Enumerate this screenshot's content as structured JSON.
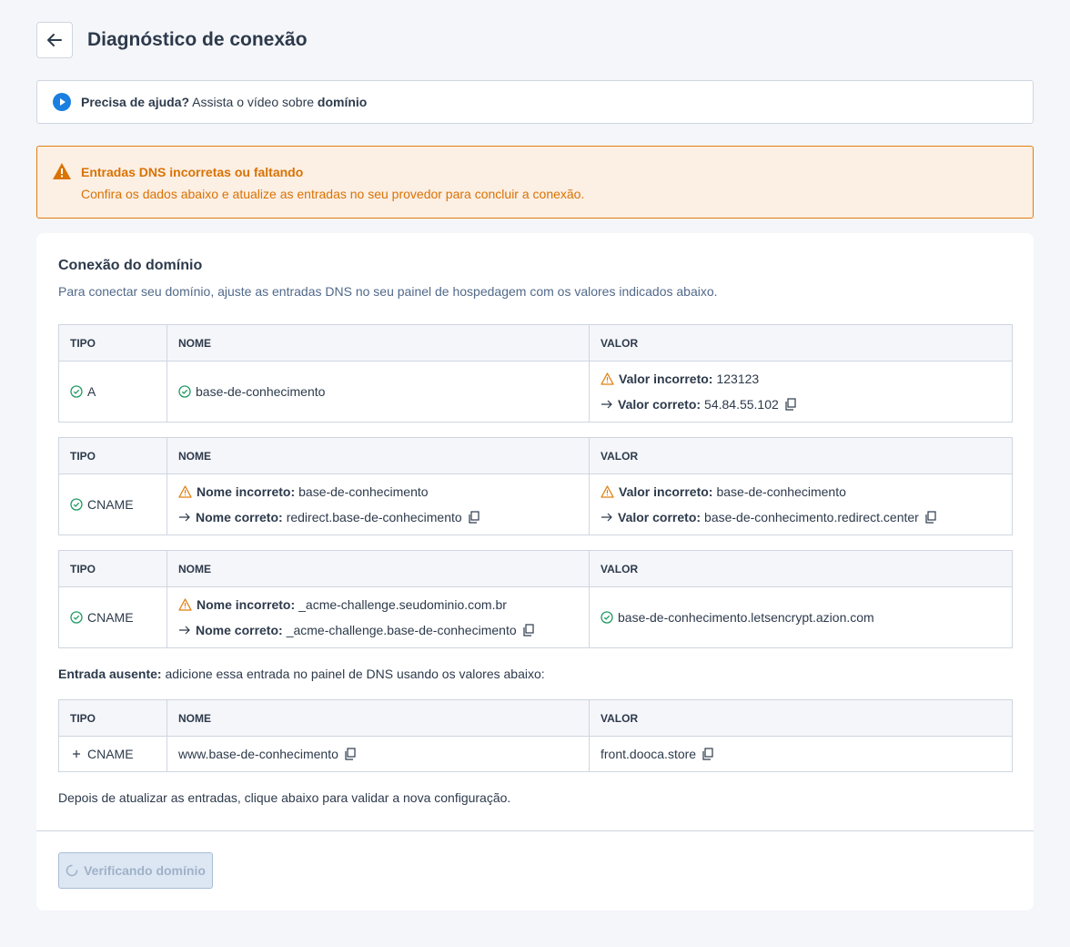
{
  "header": {
    "title": "Diagnóstico de conexão"
  },
  "help": {
    "bold": "Precisa de ajuda?",
    "text": " Assista o vídeo sobre ",
    "link": "domínio"
  },
  "alert": {
    "title": "Entradas DNS incorretas ou faltando",
    "text": "Confira os dados abaixo e atualize as entradas no seu provedor para concluir a conexão."
  },
  "card": {
    "title": "Conexão do domínio",
    "subtitle": "Para conectar seu domínio, ajuste as entradas DNS no seu painel de hospedagem com os valores indicados abaixo."
  },
  "columns": {
    "tipo": "TIPO",
    "nome": "NOME",
    "valor": "VALOR"
  },
  "labels": {
    "valor_incorreto": "Valor incorreto:",
    "valor_correto": "Valor correto:",
    "nome_incorreto": "Nome incorreto:",
    "nome_correto": "Nome correto:"
  },
  "records": [
    {
      "tipo": "A",
      "nome": "base-de-conhecimento",
      "valor_incorreto": "123123",
      "valor_correto": "54.84.55.102"
    },
    {
      "tipo": "CNAME",
      "nome_incorreto": "base-de-conhecimento",
      "nome_correto": "redirect.base-de-conhecimento",
      "valor_incorreto": "base-de-conhecimento",
      "valor_correto": "base-de-conhecimento.redirect.center"
    },
    {
      "tipo": "CNAME",
      "nome_incorreto": "_acme-challenge.seudominio.com.br",
      "nome_correto": "_acme-challenge.base-de-conhecimento",
      "valor": "base-de-conhecimento.letsencrypt.azion.com"
    }
  ],
  "absent": {
    "bold": "Entrada ausente:",
    "text": " adicione essa entrada no painel de DNS usando os valores abaixo:",
    "tipo": "CNAME",
    "nome": "www.base-de-conhecimento",
    "valor": "front.dooca.store"
  },
  "after_note": "Depois de atualizar as entradas, clique abaixo para validar a nova configuração.",
  "verify_button": "Verificando domínio",
  "colors": {
    "ok": "#1f9a62",
    "warn": "#e07f10",
    "accent": "#1a7fe0",
    "text": "#2d3a4b"
  }
}
